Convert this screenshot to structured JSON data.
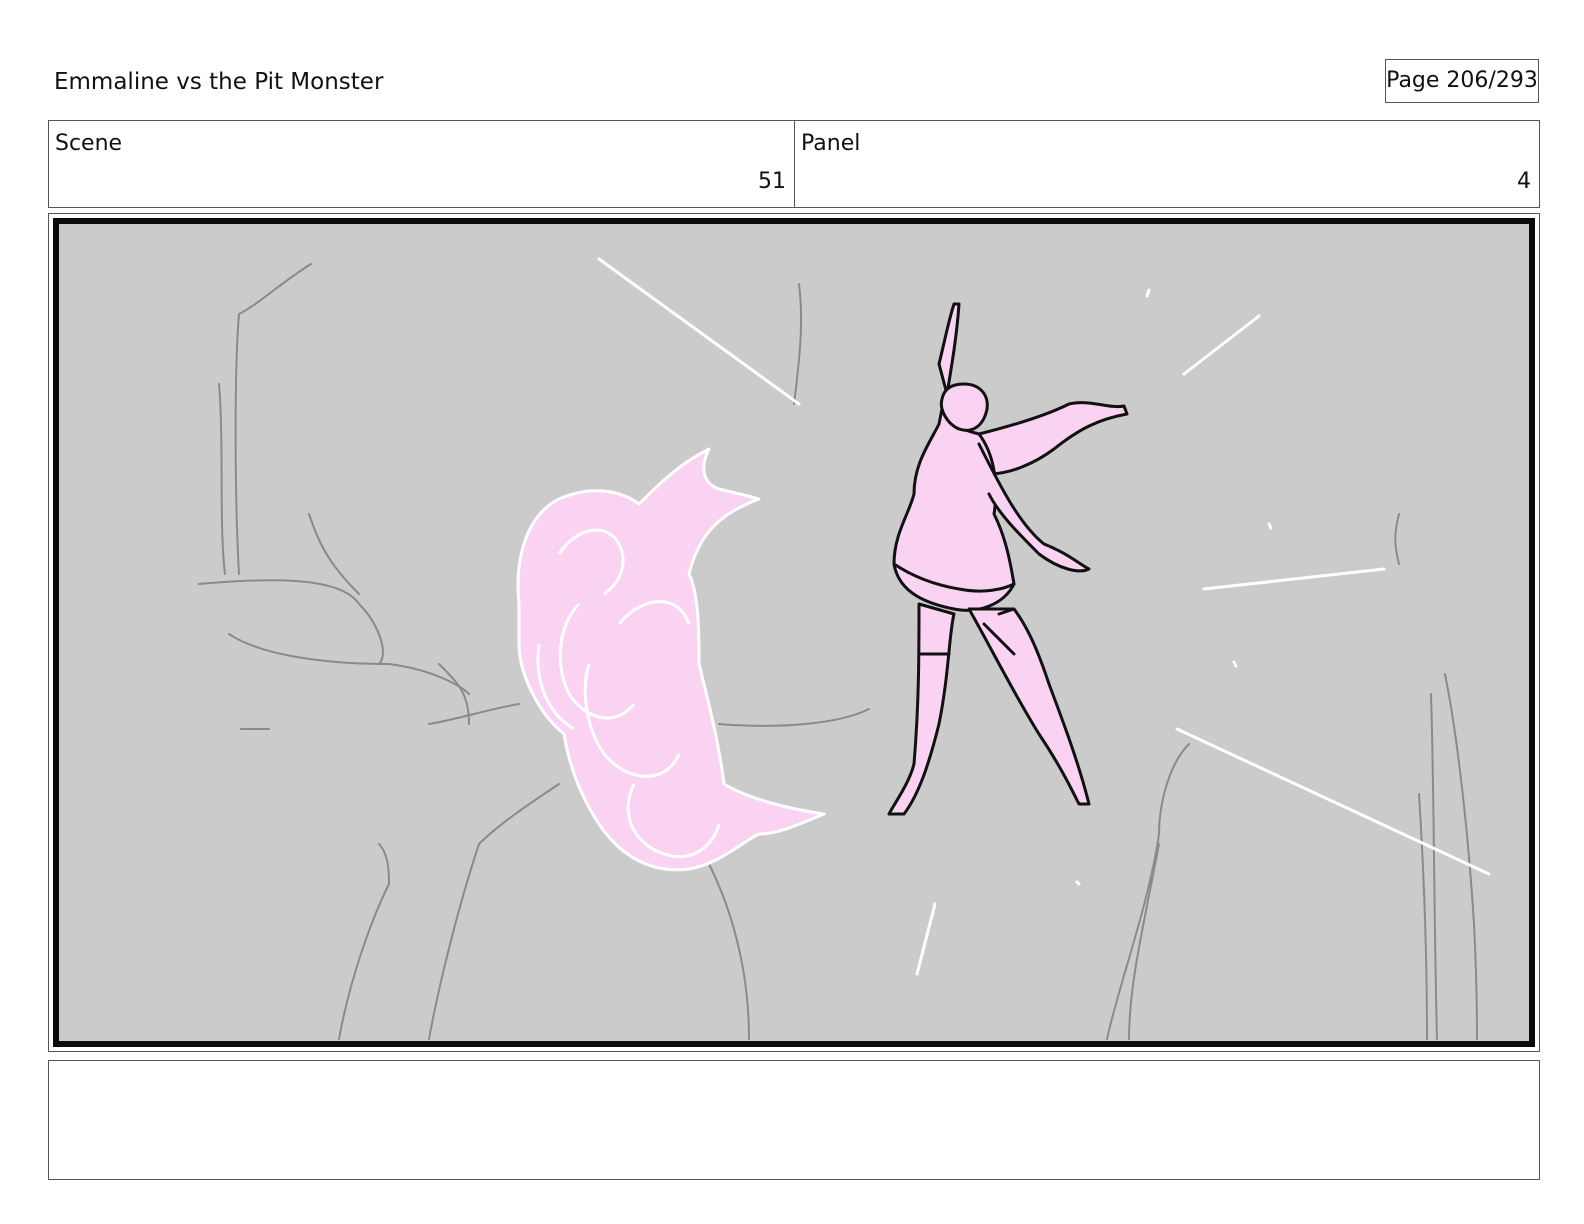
{
  "header": {
    "project_title": "Emmaline vs the Pit Monster",
    "page_label": "Page 206/293"
  },
  "fields": {
    "scene_label": "Scene",
    "scene_value": "51",
    "panel_label": "Panel",
    "panel_value": "4"
  },
  "artwork": {
    "background_color": "#cbcbcb",
    "accent_color": "#fbd3f2",
    "line_color": "#111111"
  },
  "notes": {
    "text": ""
  }
}
